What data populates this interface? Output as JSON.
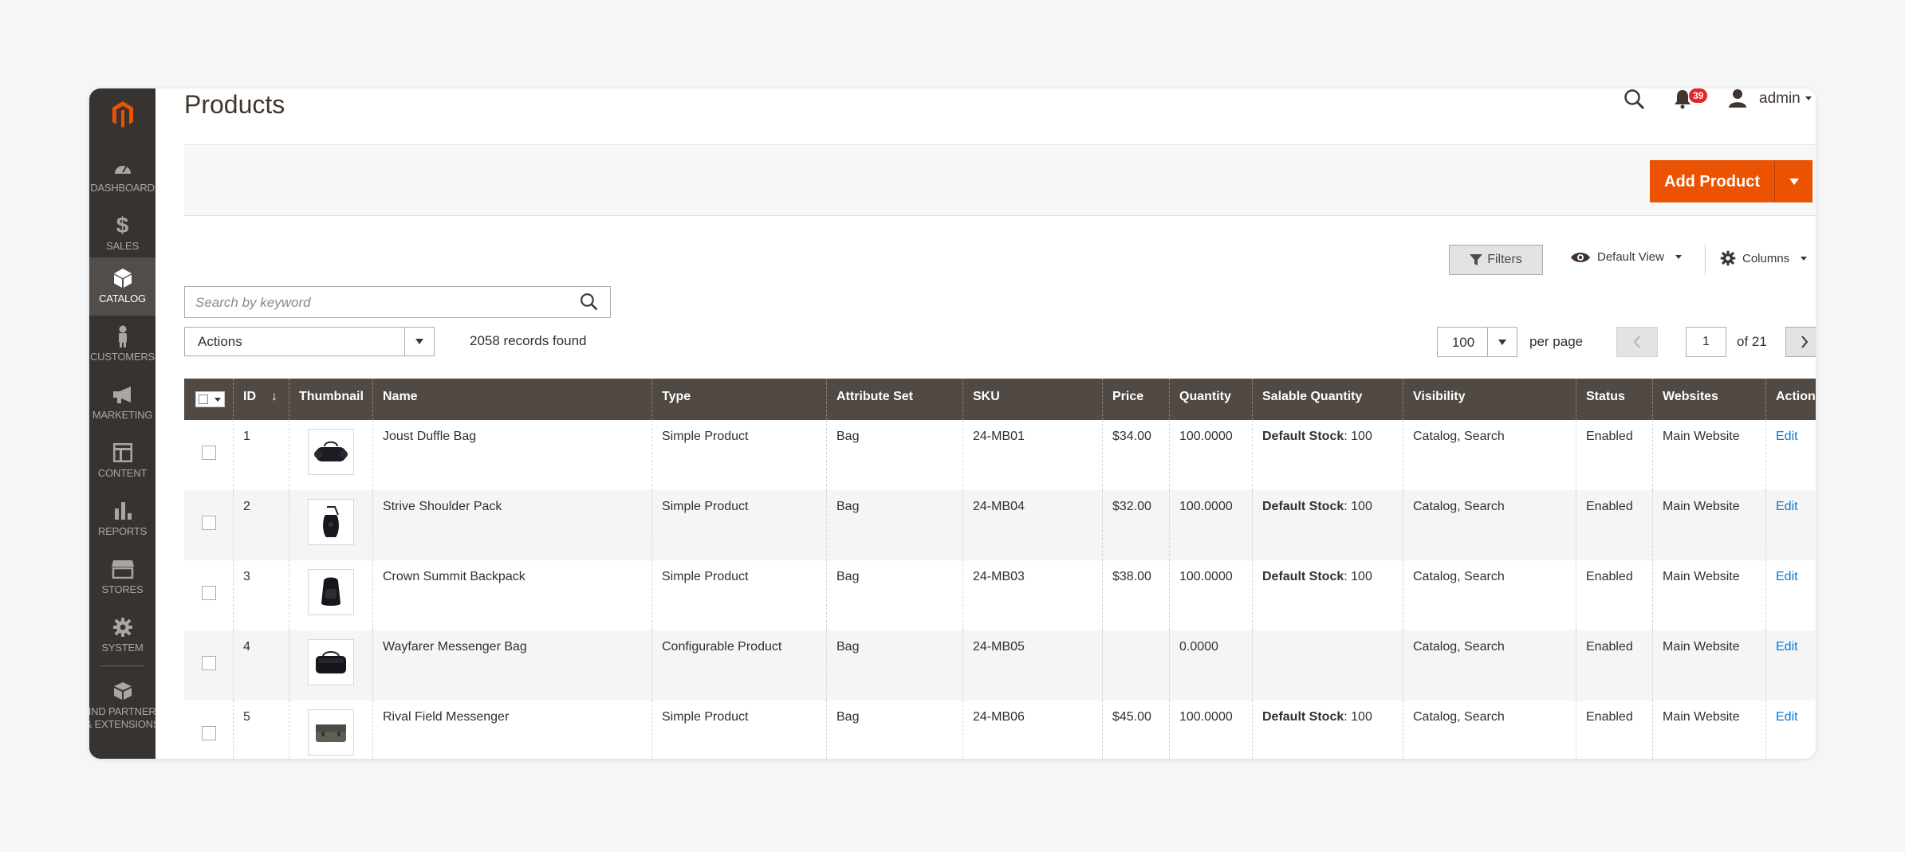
{
  "sidebar": {
    "items": [
      {
        "label": "DASHBOARD",
        "icon": "dashboard-icon"
      },
      {
        "label": "SALES",
        "icon": "dollar-icon"
      },
      {
        "label": "CATALOG",
        "icon": "cube-icon",
        "active": true
      },
      {
        "label": "CUSTOMERS",
        "icon": "person-icon"
      },
      {
        "label": "MARKETING",
        "icon": "megaphone-icon"
      },
      {
        "label": "CONTENT",
        "icon": "layout-icon"
      },
      {
        "label": "REPORTS",
        "icon": "bar-chart-icon"
      },
      {
        "label": "STORES",
        "icon": "storefront-icon"
      },
      {
        "label": "SYSTEM",
        "icon": "gear-icon"
      }
    ],
    "extra": {
      "line1": "FIND PARTNERS",
      "line2": "& EXTENSIONS",
      "icon": "box-icon"
    }
  },
  "header": {
    "title": "Products",
    "notifications_count": "39",
    "user": "admin"
  },
  "toolbar": {
    "add_product_label": "Add Product",
    "filters_label": "Filters",
    "view_label": "Default View",
    "columns_label": "Columns",
    "search_placeholder": "Search by keyword",
    "actions_label": "Actions",
    "records_found": "2058 records found",
    "per_page_value": "100",
    "per_page_label": "per page",
    "current_page": "1",
    "total_pages_label": "of 21"
  },
  "table": {
    "headers": {
      "id": "ID",
      "sort_indicator": "↓",
      "thumbnail": "Thumbnail",
      "name": "Name",
      "type": "Type",
      "attribute_set": "Attribute Set",
      "sku": "SKU",
      "price": "Price",
      "quantity": "Quantity",
      "salable_quantity": "Salable Quantity",
      "visibility": "Visibility",
      "status": "Status",
      "websites": "Websites",
      "action": "Action"
    },
    "rows": [
      {
        "id": "1",
        "name": "Joust Duffle Bag",
        "type": "Simple Product",
        "attribute_set": "Bag",
        "sku": "24-MB01",
        "price": "$34.00",
        "quantity": "100.0000",
        "salable_label": "Default Stock",
        "salable_value": ": 100",
        "visibility": "Catalog, Search",
        "status": "Enabled",
        "websites": "Main Website",
        "action": "Edit"
      },
      {
        "id": "2",
        "name": "Strive Shoulder Pack",
        "type": "Simple Product",
        "attribute_set": "Bag",
        "sku": "24-MB04",
        "price": "$32.00",
        "quantity": "100.0000",
        "salable_label": "Default Stock",
        "salable_value": ": 100",
        "visibility": "Catalog, Search",
        "status": "Enabled",
        "websites": "Main Website",
        "action": "Edit"
      },
      {
        "id": "3",
        "name": "Crown Summit Backpack",
        "type": "Simple Product",
        "attribute_set": "Bag",
        "sku": "24-MB03",
        "price": "$38.00",
        "quantity": "100.0000",
        "salable_label": "Default Stock",
        "salable_value": ": 100",
        "visibility": "Catalog, Search",
        "status": "Enabled",
        "websites": "Main Website",
        "action": "Edit"
      },
      {
        "id": "4",
        "name": "Wayfarer Messenger Bag",
        "type": "Configurable Product",
        "attribute_set": "Bag",
        "sku": "24-MB05",
        "price": "",
        "quantity": "0.0000",
        "salable_label": "",
        "salable_value": "",
        "visibility": "Catalog, Search",
        "status": "Enabled",
        "websites": "Main Website",
        "action": "Edit"
      },
      {
        "id": "5",
        "name": "Rival Field Messenger",
        "type": "Simple Product",
        "attribute_set": "Bag",
        "sku": "24-MB06",
        "price": "$45.00",
        "quantity": "100.0000",
        "salable_label": "Default Stock",
        "salable_value": ": 100",
        "visibility": "Catalog, Search",
        "status": "Enabled",
        "websites": "Main Website",
        "action": "Edit"
      }
    ]
  },
  "colors": {
    "sidebar": "#373330",
    "accent": "#eb5202",
    "table_header": "#514943",
    "link": "#007bdb",
    "badge": "#e22626"
  }
}
